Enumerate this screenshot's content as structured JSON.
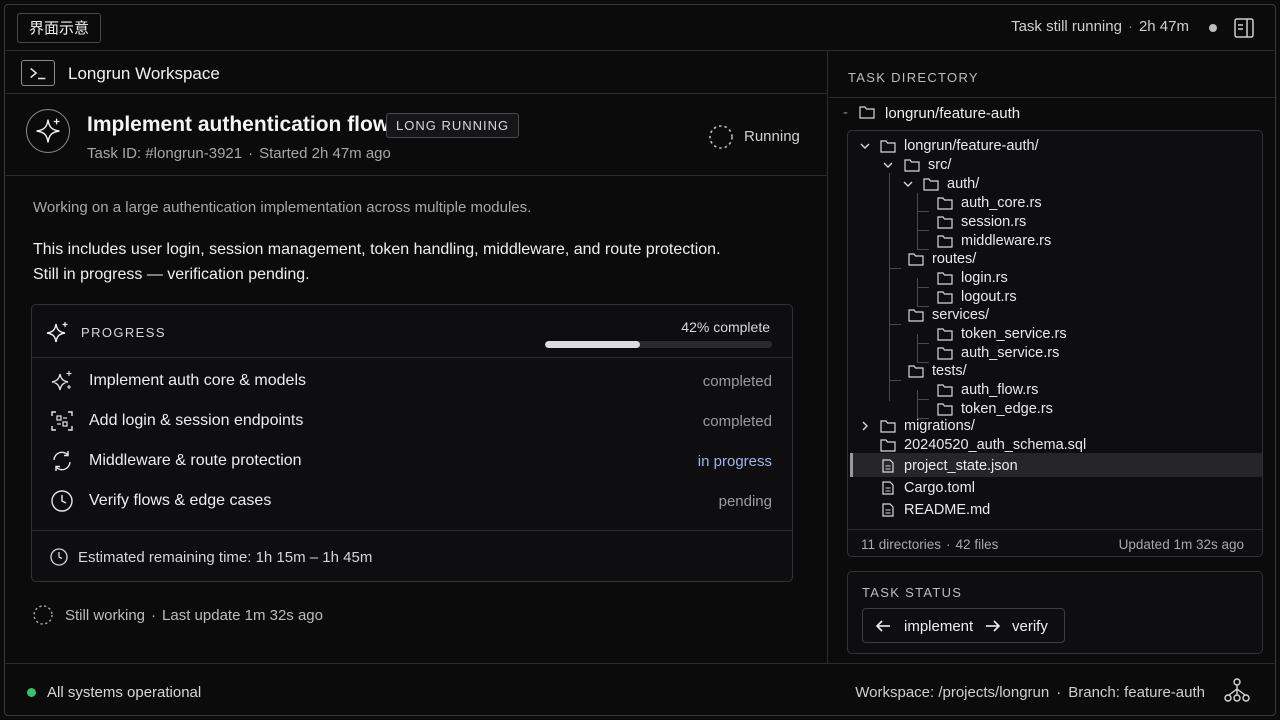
{
  "topbar": {
    "tag": "界面示意",
    "status": "Task still running",
    "elapsed": "2h 47m"
  },
  "workspace": {
    "title": "Longrun Workspace"
  },
  "task": {
    "title": "Implement authentication flow",
    "badge": "LONG RUNNING",
    "id": "Task ID: #longrun-3921",
    "started": "Started 2h 47m ago",
    "state": "Running",
    "desc1": "Working on a large authentication implementation across multiple modules.",
    "desc2": "This includes user login, session management, token handling, middleware, and route protection. Still in progress — verification pending."
  },
  "progress": {
    "title": "PROGRESS",
    "percent_label": "42% complete",
    "fraction": 0.42,
    "steps": [
      {
        "label": "Implement auth core & models",
        "status": "completed",
        "icon": "sparkles-icon"
      },
      {
        "label": "Add login & session endpoints",
        "status": "completed",
        "icon": "scan-icon"
      },
      {
        "label": "Middleware & route protection",
        "status": "in progress",
        "icon": "refresh-icon"
      },
      {
        "label": "Verify flows & edge cases",
        "status": "pending",
        "icon": "clock-icon"
      }
    ],
    "eta": "Estimated remaining time: 1h 15m – 1h 45m"
  },
  "footer_status": {
    "text": "Still working",
    "update": "Last update 1m 32s ago"
  },
  "directory": {
    "title": "TASK DIRECTORY",
    "root": "longrun/feature-auth",
    "tree": {
      "root": "longrun/feature-auth/",
      "src": "src/",
      "auth": "auth/",
      "auth_core": "auth_core.rs",
      "session": "session.rs",
      "middleware": "middleware.rs",
      "routes": "routes/",
      "login": "login.rs",
      "logout": "logout.rs",
      "services": "services/",
      "token_service": "token_service.rs",
      "auth_service": "auth_service.rs",
      "tests": "tests/",
      "auth_flow": "auth_flow.rs",
      "token_edge": "token_edge.rs",
      "migrations": "migrations/",
      "schema": "20240520_auth_schema.sql",
      "project_state": "project_state.json",
      "cargo": "Cargo.toml",
      "readme": "README.md"
    },
    "counts": "11 directories",
    "files": "42 files",
    "updated": "Updated 1m 32s ago"
  },
  "task_status": {
    "title": "TASK STATUS",
    "step1": "implement",
    "step2": "verify"
  },
  "bottombar": {
    "system": "All systems operational",
    "workspace": "Workspace: /projects/longrun",
    "branch": "Branch: feature-auth"
  },
  "colors": {
    "accent_progress": "#9fb3e6",
    "ok_green": "#3fbf6a",
    "background": "#0b0b0c"
  }
}
